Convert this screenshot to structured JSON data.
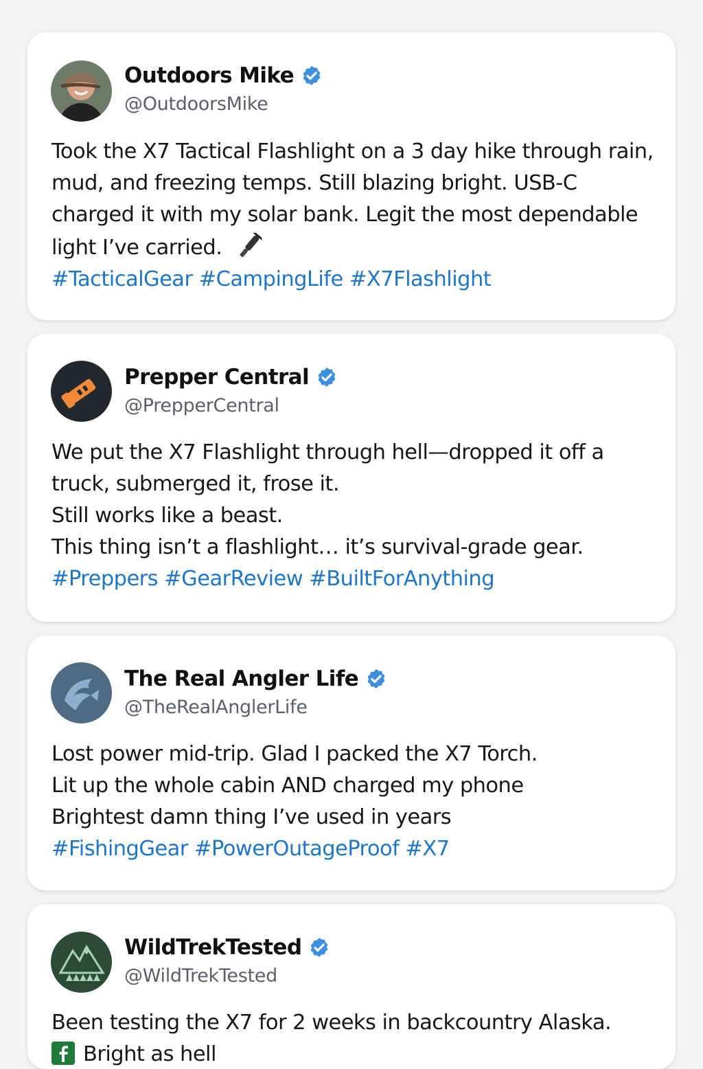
{
  "colors": {
    "background": "#f3f3f3",
    "card": "#ffffff",
    "hashtag": "#1d76c7",
    "verified": "#3f8fe0",
    "handle": "#5b6066"
  },
  "posts": [
    {
      "avatar_icon": "person-photo-avatar",
      "name": "Outdoors Mike",
      "handle": "@OutdoorsMike",
      "verified": true,
      "lines": [
        "Took the X7 Tactical Flashlight on a 3 day hike through rain,",
        "mud, and freezing temps. Still blazing bright. USB-C",
        "charged it with my solar bank. Legit the most dependable",
        "light I’ve carried."
      ],
      "inline_icon": "flashlight-icon",
      "hashtags": [
        "#TacticalGear",
        "#CampingLife",
        "#X7Flashlight"
      ]
    },
    {
      "avatar_icon": "flashlight-logo-avatar",
      "name": "Prepper Central",
      "handle": "@PrepperCentral",
      "verified": true,
      "lines": [
        "We put the X7 Flashlight through hell—dropped it off a",
        "truck, submerged it, frose it.",
        "Still works like a beast.",
        "This thing isn’t a flashlight… it’s survival-grade gear."
      ],
      "hashtags": [
        "#Preppers",
        "#GearReview",
        "#BuiltForAnything"
      ]
    },
    {
      "avatar_icon": "fish-logo-avatar",
      "name": "The Real Angler Life",
      "handle": "@TheRealAnglerLife",
      "verified": true,
      "lines": [
        "Lost power mid-trip. Glad I packed the X7 Torch.",
        "Lit up the whole cabin AND charged my phone",
        "Brightest damn thing I’ve used in years"
      ],
      "hashtags": [
        "#FishingGear",
        "#PowerOutageProof",
        "#X7"
      ]
    },
    {
      "avatar_icon": "mountains-trees-logo-avatar",
      "name": "WildTrekTested",
      "handle": "@WildTrekTested",
      "verified": true,
      "lines": [
        "Been testing the X7 for 2 weeks in backcountry Alaska.",
        "Bright as hell"
      ],
      "line_icon": "facebook-icon"
    }
  ]
}
